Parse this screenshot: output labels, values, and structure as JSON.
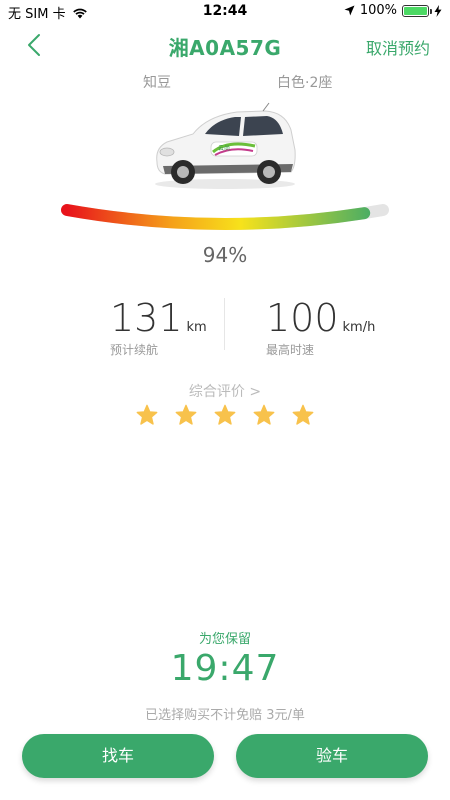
{
  "status_bar": {
    "carrier": "无 SIM 卡",
    "time": "12:44",
    "battery": "100%",
    "battery_level": 1.0,
    "icons": [
      "wifi-icon",
      "location-arrow-icon",
      "battery-icon",
      "charging-bolt-icon"
    ]
  },
  "nav": {
    "back_icon": "chevron-left-icon",
    "title": "湘A0A57G",
    "action": "取消预约"
  },
  "car": {
    "brand": "知豆",
    "color_seats": "白色·2座",
    "image_icon": "car-image"
  },
  "battery_gauge": {
    "level": 0.94,
    "percent_text": "94%",
    "gradient_colors": [
      "#e8131b",
      "#f7e21b",
      "#3aa86b"
    ],
    "track_color": "#e4e4e4"
  },
  "stats": {
    "range_value": "131",
    "range_unit": "km",
    "range_label": "预计续航",
    "speed_value": "100",
    "speed_unit": "km/h",
    "speed_label": "最高时速"
  },
  "rating": {
    "link_text": "综合评价 >",
    "stars": 5,
    "star_color": "#f8c24c"
  },
  "reservation": {
    "label": "为您保留",
    "countdown": "19:47",
    "notice": "已选择购买不计免赔 3元/单"
  },
  "actions": {
    "find_car": "找车",
    "inspect_car": "验车"
  },
  "colors": {
    "accent": "#3aa86b"
  }
}
